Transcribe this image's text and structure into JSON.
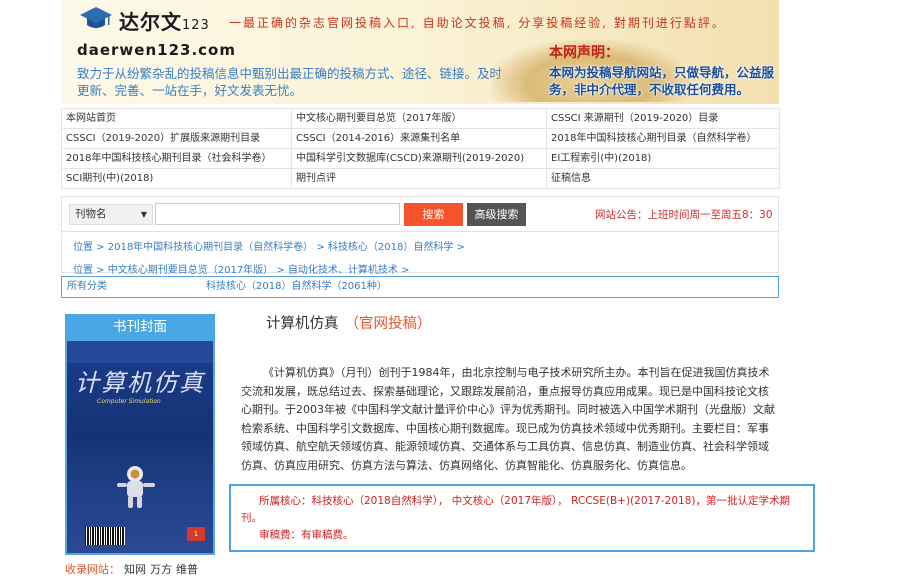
{
  "header": {
    "logo_text": "达尔文",
    "logo_num": "123",
    "slogan": "一最正确的杂志官网投稿入口, 自助论文投稿, 分享投稿经验, 對期刊进行點評。",
    "domain": "daerwen123.com",
    "tagline": "致力于从纷繁杂乱的投稿信息中甄别出最正确的投稿方式、途径、链接。及时更新、完善、一站在手，好文发表无忧。",
    "declaration_title": "本网声明：",
    "declaration_text": "本网为投稿导航网站，只做导航，公益服务，非中介代理，不收取任何费用。"
  },
  "nav": [
    [
      "本网站首页",
      "中文核心期刊要目总览（2017年版）",
      "CSSCI 来源期刊（2019-2020）目录"
    ],
    [
      "CSSCI（2019-2020）扩展版来源期刊目录",
      "CSSCI（2014-2016）来源集刊名单",
      "2018年中国科技核心期刊目录（自然科学卷）"
    ],
    [
      "2018年中国科技核心期刊目录（社会科学卷）",
      "中国科学引文数据库(CSCD)来源期刊(2019-2020)",
      "EI工程索引(中)(2018)"
    ],
    [
      "SCI期刊(中)(2018)",
      "期刊点评",
      "征稿信息"
    ]
  ],
  "search": {
    "select_value": "刊物名",
    "input_value": "",
    "search_label": "搜索",
    "advanced_label": "高级搜索",
    "notice": "网站公告：上班时间周一至周五8：30"
  },
  "breadcrumbs": {
    "row1": "位置 > 2018年中国科技核心期刊目录（自然科学卷） > 科技核心（2018）自然科学 >",
    "row2": "位置 > 中文核心期刊要目总览（2017年版） > 自动化技术、计算机技术 >"
  },
  "category": {
    "all": "所有分类",
    "current": "科技核心（2018）自然科学（2061种）"
  },
  "cover": {
    "heading": "书刊封面",
    "title": "计算机仿真",
    "subtitle": "Computer Simulation",
    "badge": "1",
    "source_label": "收录网站：",
    "sites": [
      "知网",
      "万方",
      "维普"
    ]
  },
  "journal": {
    "title": "计算机仿真",
    "official": "（官网投稿）",
    "description": "《计算机仿真》（月刊）创刊于1984年，由北京控制与电子技术研究所主办。本刊旨在促进我国仿真技术交流和发展，既总结过去、探索基础理论，又跟踪发展前沿，重点报导仿真应用成果。现已是中国科技论文核心期刊。于2003年被《中国科学文献计量评价中心》评为优秀期刊。同时被选入中国学术期刊（光盘版）文献检索系统、中国科学引文数据库、中国核心期刊数据库。现已成为仿真技术领域中优秀期刊。主要栏目：军事领域仿真、航空航天领域仿真、能源领域仿真、交通体系与工具仿真、信息仿真、制造业仿真、社会科学领域仿真、仿真应用研究、仿真方法与算法、仿真网络化、仿真智能化、仿真服务化、仿真信息。",
    "core": "所属核心：科技核心（2018自然科学）， 中文核心（2017年版）， RCCSE(B+)(2017-2018)，第一批认定学术期刊。",
    "fee": "审稿费：有审稿费。"
  },
  "colors": {
    "accent_orange": "#f4532c",
    "link_blue": "#3a7dc4",
    "red_text": "#d22121",
    "cover_header": "#4aa7e6"
  }
}
